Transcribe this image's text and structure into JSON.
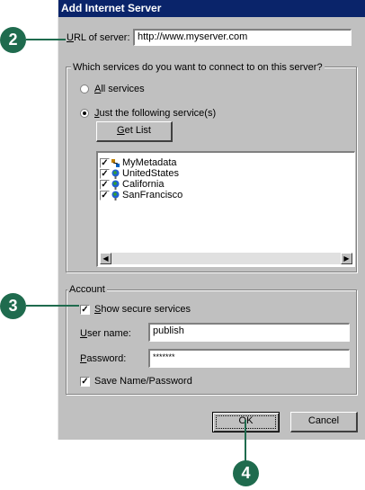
{
  "dialog": {
    "title": "Add Internet Server",
    "url_label_u": "U",
    "url_label_rest": "RL of server:",
    "url_value": "http://www.myserver.com",
    "services_group_label": "Which services do you want to connect to on this server?",
    "radio_all_u": "A",
    "radio_all_rest": "ll services",
    "radio_just_u": "J",
    "radio_just_rest": "ust the following service(s)",
    "get_list_u": "G",
    "get_list_rest": "et List",
    "services": [
      {
        "name": "MyMetadata",
        "checked": true,
        "icon": "metadata-icon"
      },
      {
        "name": "UnitedStates",
        "checked": true,
        "icon": "globe-icon"
      },
      {
        "name": "California",
        "checked": true,
        "icon": "globe-icon"
      },
      {
        "name": "SanFrancisco",
        "checked": true,
        "icon": "globe-icon"
      }
    ],
    "account_group_label": "Account",
    "show_secure_u": "S",
    "show_secure_rest": "how secure services",
    "username_u": "U",
    "username_rest": "ser name:",
    "username_value": "publish",
    "password_u": "P",
    "password_rest": "assword:",
    "password_value": "*******",
    "save_label": "Save Name/Password",
    "ok_label": "OK",
    "cancel_label": "Cancel"
  },
  "callouts": [
    "2",
    "3",
    "4"
  ],
  "colors": {
    "callout": "#1f6b4e",
    "titlebar": "#0a246a",
    "dialog": "#c0c0c0"
  }
}
